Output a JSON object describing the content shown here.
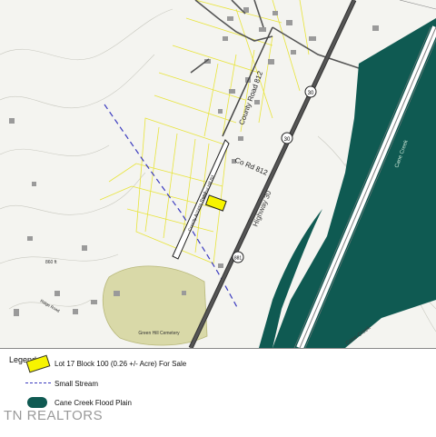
{
  "map": {
    "road_labels": {
      "county_road": "County Road 812",
      "co_rd": "Co Rd 812",
      "highway": "Highway 30",
      "route_badge": "30",
      "route_badge_2": "30",
      "route_badge_3": "881",
      "river": "Cane Creek",
      "river_2": "Cane Creek",
      "county_access": "County Access Road",
      "street_a": "Walnut Hill Rd",
      "street_b": "Ridge Road"
    },
    "place_labels": {
      "cemetery": "Green Hill Cemetery",
      "elevation": "860 ft"
    },
    "colors": {
      "lot": "#f7f400",
      "flood": "#0f5a52",
      "stream": "#3b3bbf",
      "parcel_lines": "#e8e43a",
      "park": "#d9d9a8"
    }
  },
  "legend": {
    "title": "Legend",
    "items": [
      {
        "symbol": "yellow-lot-rect",
        "label": "Lot 17 Block 100 (0.26 +/- Acre)  For Sale"
      },
      {
        "symbol": "dashed-blue-line",
        "label": "Small Stream"
      },
      {
        "symbol": "teal-blob",
        "label": "Cane Creek Flood Plain"
      }
    ]
  },
  "watermark": "TN REALTORS"
}
